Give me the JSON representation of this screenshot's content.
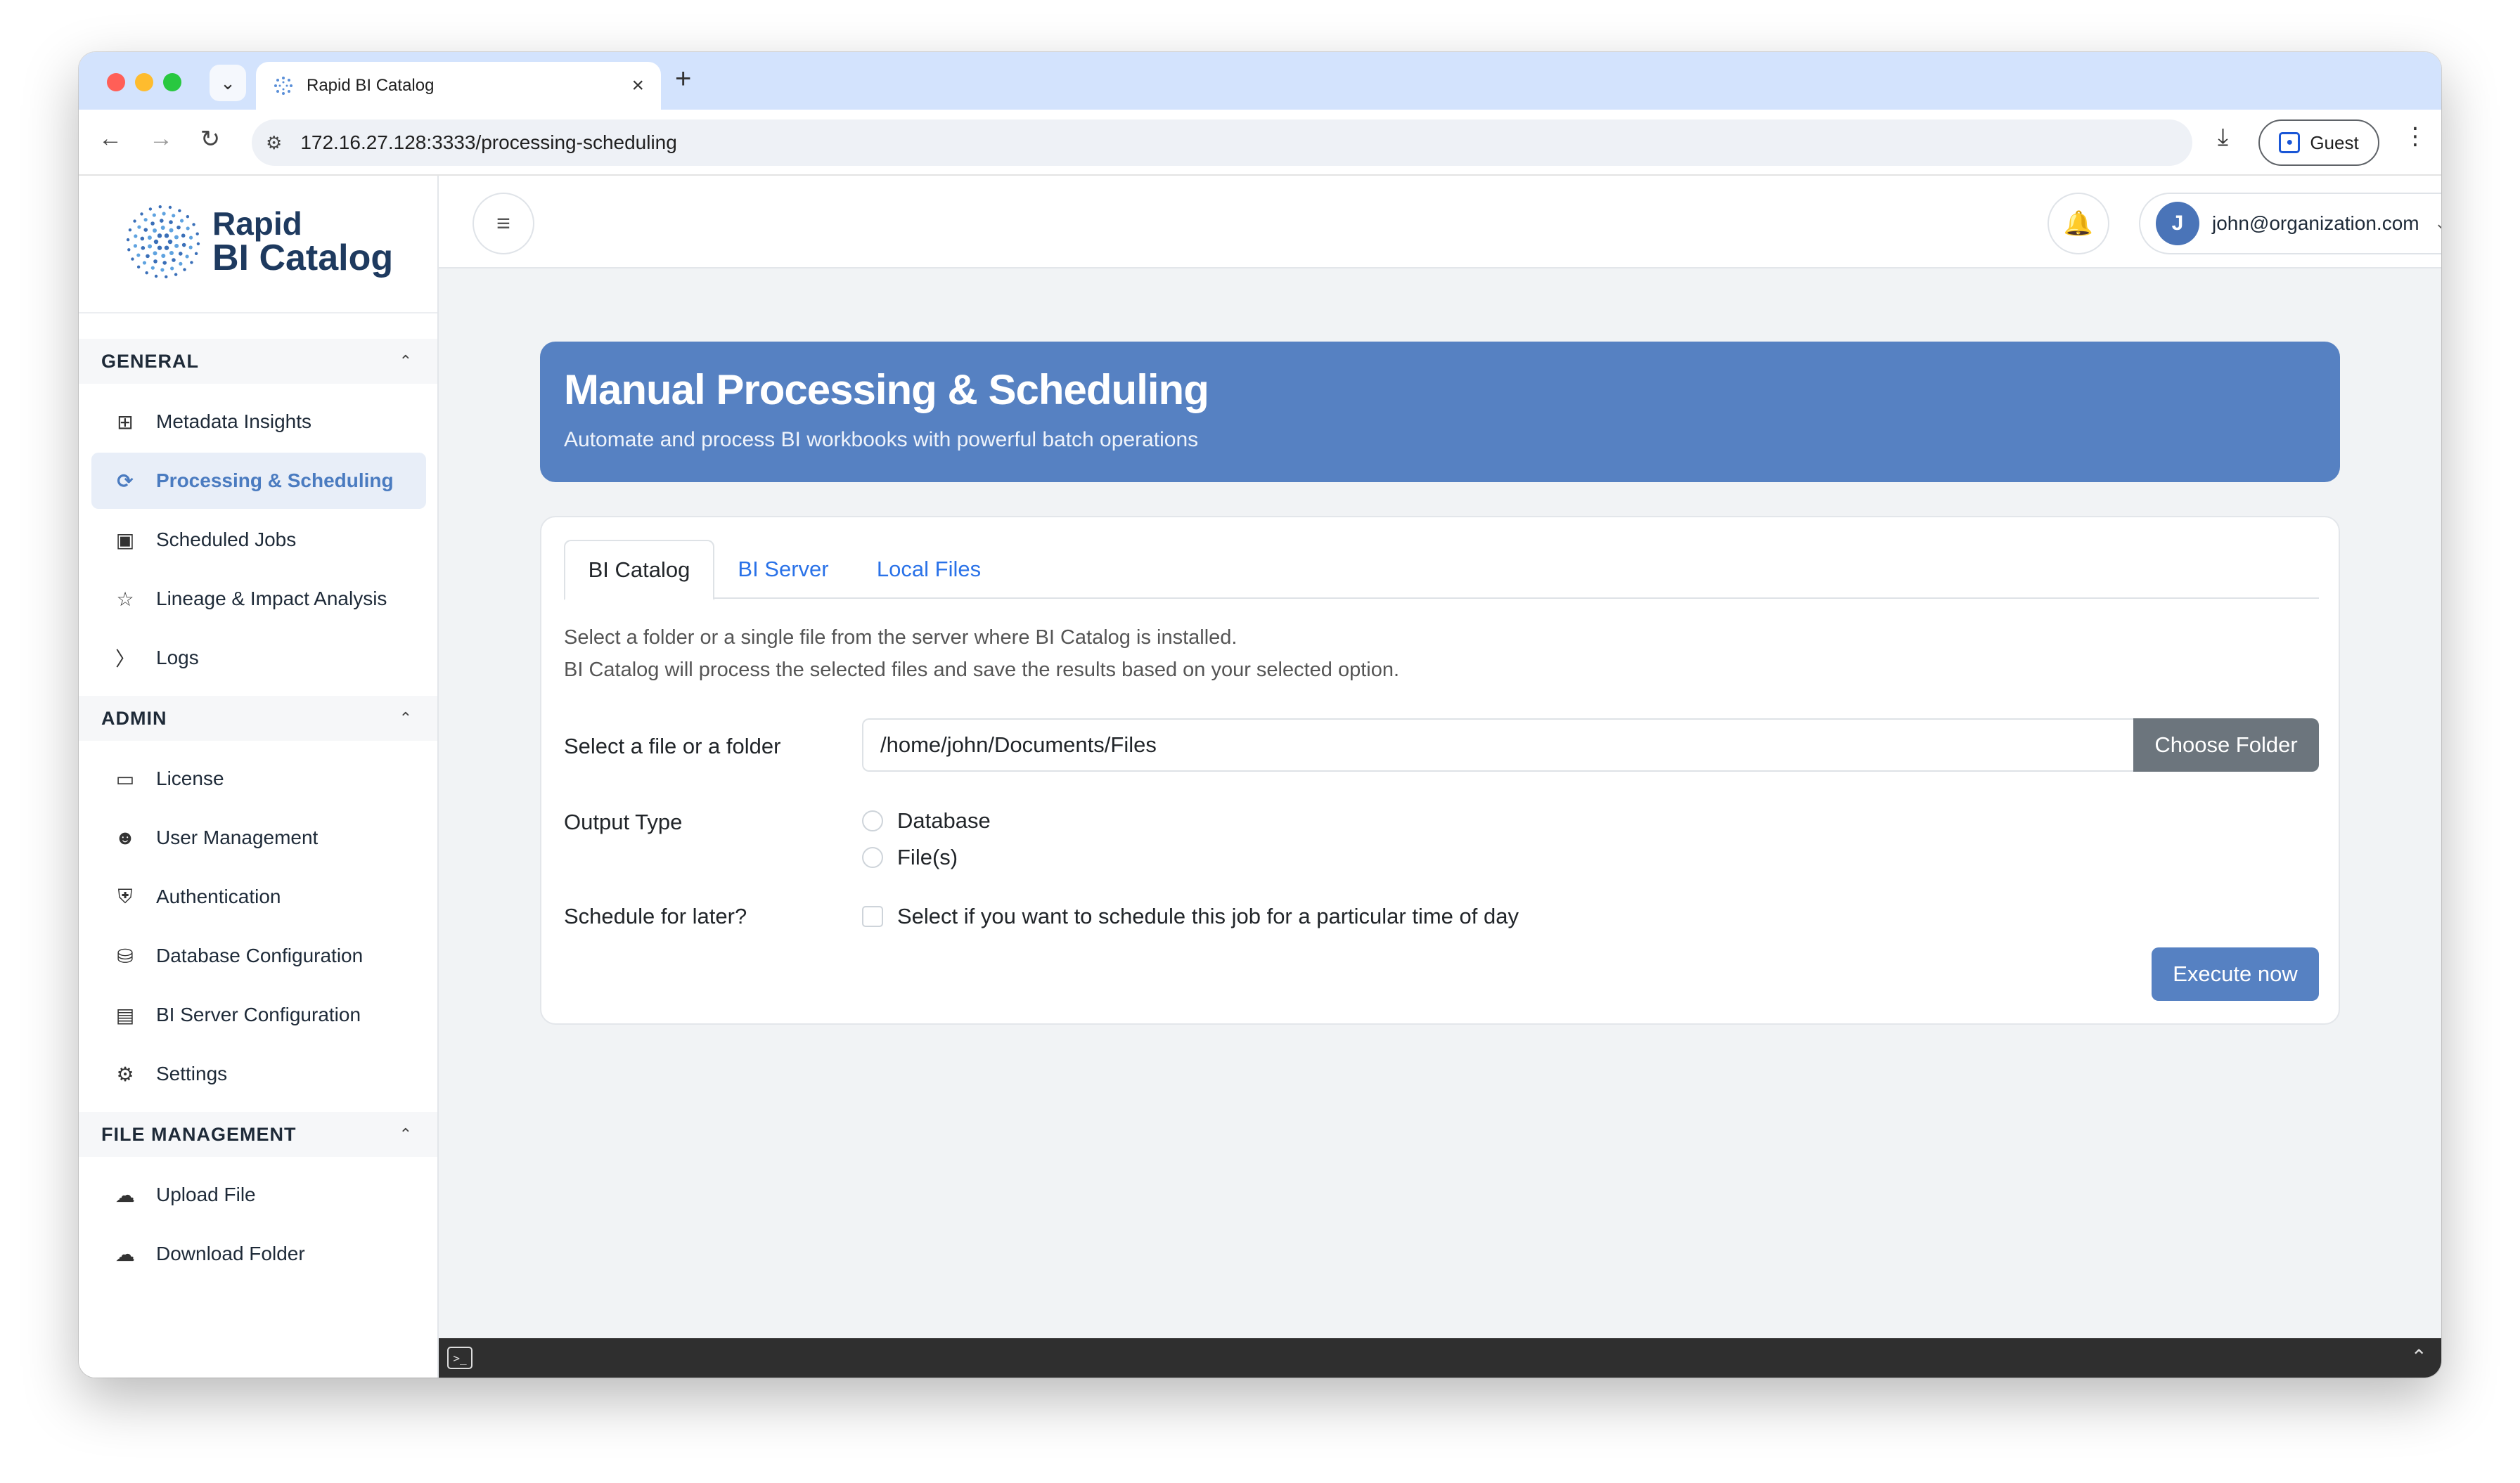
{
  "browser": {
    "tab_title": "Rapid BI Catalog",
    "url": "172.16.27.128:3333/processing-scheduling",
    "profile_label": "Guest"
  },
  "logo": {
    "line1": "Rapid",
    "line2": "BI Catalog"
  },
  "sidebar": {
    "sections": [
      {
        "title": "GENERAL",
        "items": [
          {
            "label": "Metadata Insights",
            "icon": "grid-icon",
            "active": false
          },
          {
            "label": "Processing & Scheduling",
            "icon": "process-icon",
            "active": true
          },
          {
            "label": "Scheduled Jobs",
            "icon": "window-icon",
            "active": false
          },
          {
            "label": "Lineage & Impact Analysis",
            "icon": "lineage-icon",
            "active": false
          },
          {
            "label": "Logs",
            "icon": "terminal-icon",
            "active": false
          }
        ]
      },
      {
        "title": "ADMIN",
        "items": [
          {
            "label": "License",
            "icon": "ticket-icon",
            "active": false
          },
          {
            "label": "User Management",
            "icon": "users-icon",
            "active": false
          },
          {
            "label": "Authentication",
            "icon": "shield-icon",
            "active": false
          },
          {
            "label": "Database Configuration",
            "icon": "database-icon",
            "active": false
          },
          {
            "label": "BI Server Configuration",
            "icon": "server-icon",
            "active": false
          },
          {
            "label": "Settings",
            "icon": "gear-icon",
            "active": false
          }
        ]
      },
      {
        "title": "FILE MANAGEMENT",
        "items": [
          {
            "label": "Upload File",
            "icon": "cloud-upload-icon",
            "active": false
          },
          {
            "label": "Download Folder",
            "icon": "cloud-download-icon",
            "active": false
          }
        ]
      }
    ]
  },
  "header": {
    "user_initial": "J",
    "user_email": "john@organization.com"
  },
  "banner": {
    "title": "Manual Processing & Scheduling",
    "subtitle": "Automate and process BI workbooks with powerful batch operations"
  },
  "tabs": [
    {
      "label": "BI Catalog",
      "active": true
    },
    {
      "label": "BI Server",
      "active": false
    },
    {
      "label": "Local Files",
      "active": false
    }
  ],
  "form": {
    "description_line1": "Select a folder or a single file from the server where BI Catalog is installed.",
    "description_line2": "BI Catalog will process the selected files and save the results based on your selected option.",
    "file_label": "Select a file or a folder",
    "file_value": "/home/john/Documents/Files",
    "choose_button": "Choose Folder",
    "output_label": "Output Type",
    "output_options": [
      "Database",
      "File(s)"
    ],
    "schedule_label": "Schedule for later?",
    "schedule_checkbox_label": "Select if you want to schedule this job for a particular time of day",
    "execute_button": "Execute now"
  },
  "colors": {
    "primary": "#5681c2",
    "link": "#2a72e8",
    "secondary_button": "#6c757d"
  }
}
